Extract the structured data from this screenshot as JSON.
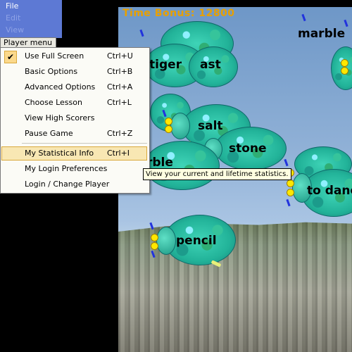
{
  "menubar": {
    "items": [
      {
        "label": "File",
        "enabled": true
      },
      {
        "label": "Edit",
        "enabled": false
      },
      {
        "label": "View",
        "enabled": false
      }
    ],
    "open_menu": "Player menu"
  },
  "game": {
    "bonus_text": "Time Bonus: 12800",
    "beetle_words": [
      "marble",
      "tiger",
      "ast",
      "salt",
      "stone",
      "rble",
      "to danc",
      "pencil"
    ]
  },
  "dropdown": {
    "items": [
      {
        "label": "Use Full Screen",
        "shortcut": "Ctrl+U",
        "checked": true
      },
      {
        "label": "Basic Options",
        "shortcut": "Ctrl+B"
      },
      {
        "label": "Advanced Options",
        "shortcut": "Ctrl+A"
      },
      {
        "label": "Choose Lesson",
        "shortcut": "Ctrl+L"
      },
      {
        "label": "View High Scorers",
        "shortcut": ""
      },
      {
        "label": "Pause Game",
        "shortcut": "Ctrl+Z"
      },
      {
        "label": "My Statistical Info",
        "shortcut": "Ctrl+I",
        "highlighted": true
      },
      {
        "label": "My Login Preferences",
        "shortcut": ""
      },
      {
        "label": "Login / Change Player",
        "shortcut": ""
      }
    ]
  },
  "tooltip": "View your current and lifetime statistics.",
  "colors": {
    "menu_bar": "#5d79d4",
    "bonus": "#e8a000",
    "highlight": "#f8e7b3"
  }
}
